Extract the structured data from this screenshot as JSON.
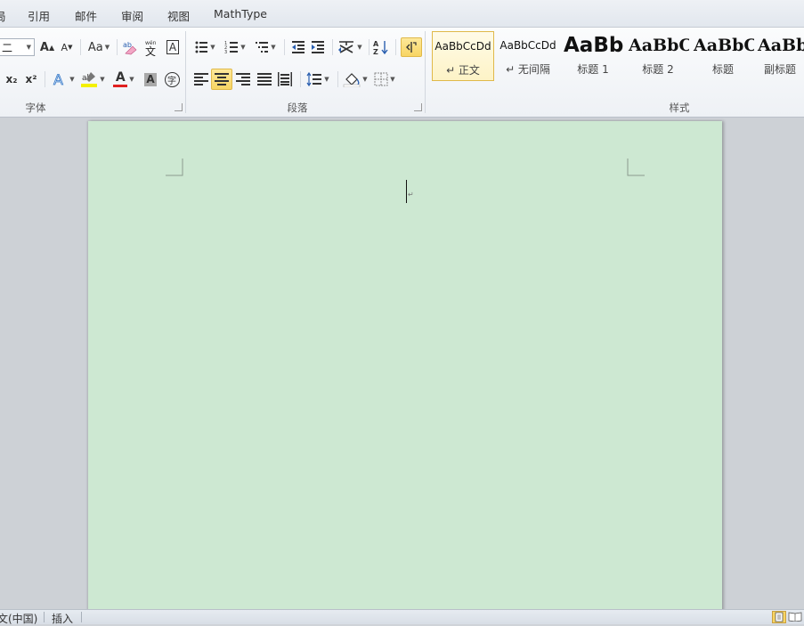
{
  "tabs": [
    "局",
    "引用",
    "邮件",
    "审阅",
    "视图",
    "MathType"
  ],
  "font_group": {
    "label": "字体",
    "font_size_value": "二",
    "grow_font": "A",
    "shrink_font": "A",
    "change_case": "Aa",
    "subscript": "x₂",
    "superscript": "x²",
    "font_color_letter": "A",
    "char_shading_letter": "A",
    "enclose_char": "字",
    "char_border_letter": "A"
  },
  "paragraph_group": {
    "label": "段落"
  },
  "styles_group": {
    "label": "样式",
    "items": [
      {
        "sample": "AaBbCcDd",
        "name": "↵ 正文",
        "selected": true
      },
      {
        "sample": "AaBbCcDd",
        "name": "↵ 无间隔",
        "selected": false
      },
      {
        "sample": "AaBb",
        "name": "标题 1",
        "selected": false
      },
      {
        "sample": "AaBbC",
        "name": "标题 2",
        "selected": false
      },
      {
        "sample": "AaBbC",
        "name": "标题",
        "selected": false
      },
      {
        "sample": "AaBb",
        "name": "副标题",
        "selected": false
      }
    ]
  },
  "document": {
    "page_color": "#cde8d2"
  },
  "statusbar": {
    "language": "文(中国)",
    "insert_mode": "插入"
  },
  "colors": {
    "accent_highlight": "#f8d563",
    "font_color": "#e02020",
    "highlight_color": "#f4f000"
  }
}
